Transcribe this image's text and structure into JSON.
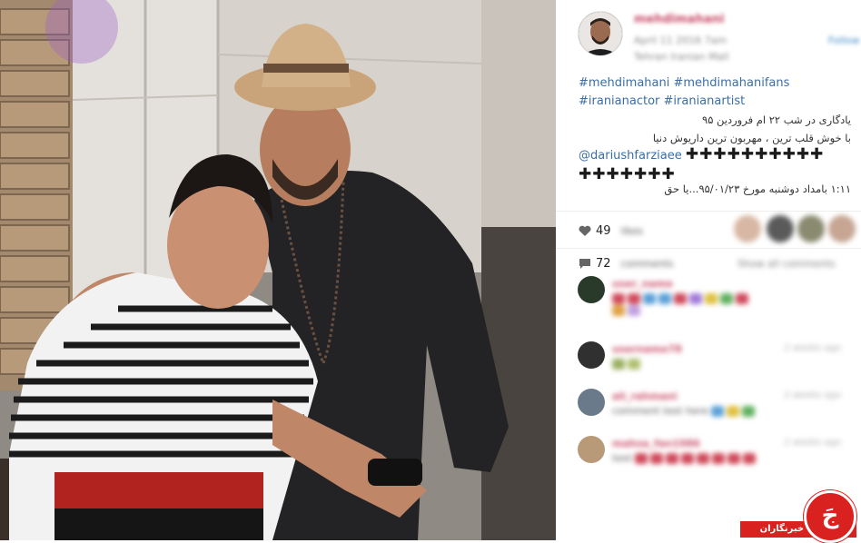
{
  "post": {
    "hashtags_line1": "#mehdimahani #mehdimahanifans",
    "hashtags_line2": "#iranianactor #iranianartist",
    "caption_line1": "یادگاری در شب ۲۲ ام فروردین ۹۵",
    "caption_line2": "با خوش قلب ترین ، مهربون ترین داریوش دنیا",
    "mention": "@dariushfarziaee",
    "plus_line1": "✚✚✚✚✚✚✚✚✚✚",
    "plus_line2": "✚✚✚✚✚✚✚",
    "timeline": "۱:۱۱ بامداد دوشنبه مورخ ۹۵/۰۱/۲۳...یا حق",
    "likes_count": "49",
    "comments_count": "72"
  },
  "watermark": {
    "label": "باشگاه خبرنگاران",
    "glyph": "جَ",
    "brand_color": "#d9211f"
  },
  "icons": {
    "like": "heart-icon",
    "comment": "speech-bubble-icon"
  }
}
